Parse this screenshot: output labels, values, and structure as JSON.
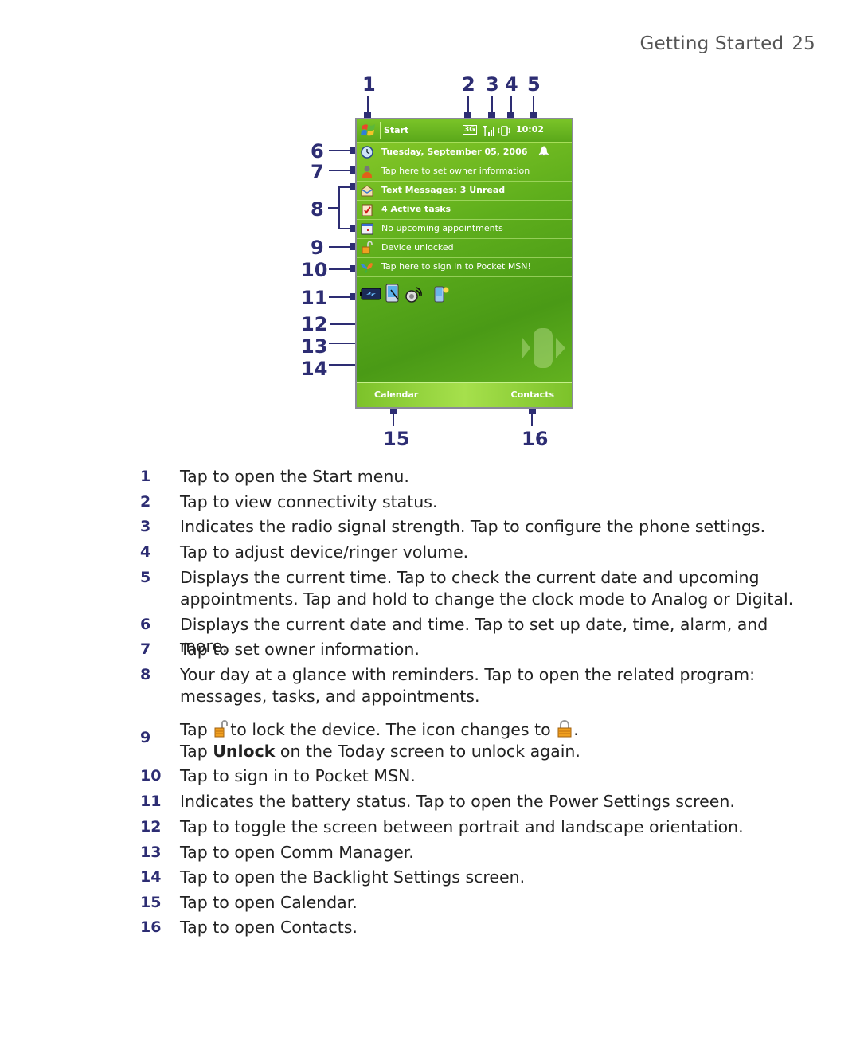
{
  "header": {
    "section": "Getting Started",
    "page": "25"
  },
  "callouts": [
    "1",
    "2",
    "3",
    "4",
    "5",
    "6",
    "7",
    "8",
    "9",
    "10",
    "11",
    "12",
    "13",
    "14",
    "15",
    "16"
  ],
  "screen": {
    "start_label": "Start",
    "status_icons": [
      "connectivity-3g-icon",
      "signal-icon",
      "volume-icon"
    ],
    "time": "10:02",
    "rows": [
      {
        "icon": "clock-icon",
        "text": "Tuesday, September 05, 2006",
        "bold": true,
        "alarm": true
      },
      {
        "icon": "owner-icon",
        "text": "Tap here to set owner information",
        "bold": false
      },
      {
        "icon": "messages-icon",
        "text": "Text Messages: 3 Unread",
        "bold": true
      },
      {
        "icon": "tasks-icon",
        "text": "4 Active tasks",
        "bold": true
      },
      {
        "icon": "calendar-icon",
        "text": "No upcoming appointments",
        "bold": false
      },
      {
        "icon": "unlocked-icon",
        "text": "Device unlocked",
        "bold": false
      },
      {
        "icon": "msn-butterfly-icon",
        "text": "Tap here to sign in to Pocket MSN!",
        "bold": false
      }
    ],
    "tray_icons": [
      "battery-icon",
      "rotate-screen-icon",
      "comm-manager-icon",
      "backlight-icon"
    ],
    "softkeys": {
      "left": "Calendar",
      "right": "Contacts"
    }
  },
  "descriptions": [
    {
      "n": "1",
      "text": "Tap to open the Start menu."
    },
    {
      "n": "2",
      "text": "Tap to view connectivity status."
    },
    {
      "n": "3",
      "text": "Indicates the radio signal strength. Tap to configure the phone settings."
    },
    {
      "n": "4",
      "text": "Tap to adjust device/ringer volume."
    },
    {
      "n": "5",
      "text": "Displays the current time. Tap to check the current date and upcoming appointments. Tap and hold to change the clock mode to Analog or Digital."
    },
    {
      "n": "6",
      "text": "Displays the current date and time. Tap to set up date, time, alarm, and more."
    },
    {
      "n": "7",
      "text": "Tap to set owner information."
    },
    {
      "n": "8",
      "text": "Your day at a glance with reminders. Tap to open the related program: messages, tasks, and appointments."
    },
    {
      "n": "9",
      "text_a": "Tap",
      "text_b": "to lock the device. The icon changes to",
      "text_c": ".",
      "text_d": "Tap",
      "bold": "Unlock",
      "text_e": "on the Today screen to unlock again."
    },
    {
      "n": "10",
      "text": "Tap to sign in to Pocket MSN."
    },
    {
      "n": "11",
      "text": "Indicates the battery status. Tap to open the Power Settings screen."
    },
    {
      "n": "12",
      "text": "Tap to toggle the screen between portrait and landscape orientation."
    },
    {
      "n": "13",
      "text": "Tap to open Comm Manager."
    },
    {
      "n": "14",
      "text": "Tap to open the Backlight Settings screen."
    },
    {
      "n": "15",
      "text": "Tap to open Calendar."
    },
    {
      "n": "16",
      "text": "Tap to open Contacts."
    }
  ]
}
